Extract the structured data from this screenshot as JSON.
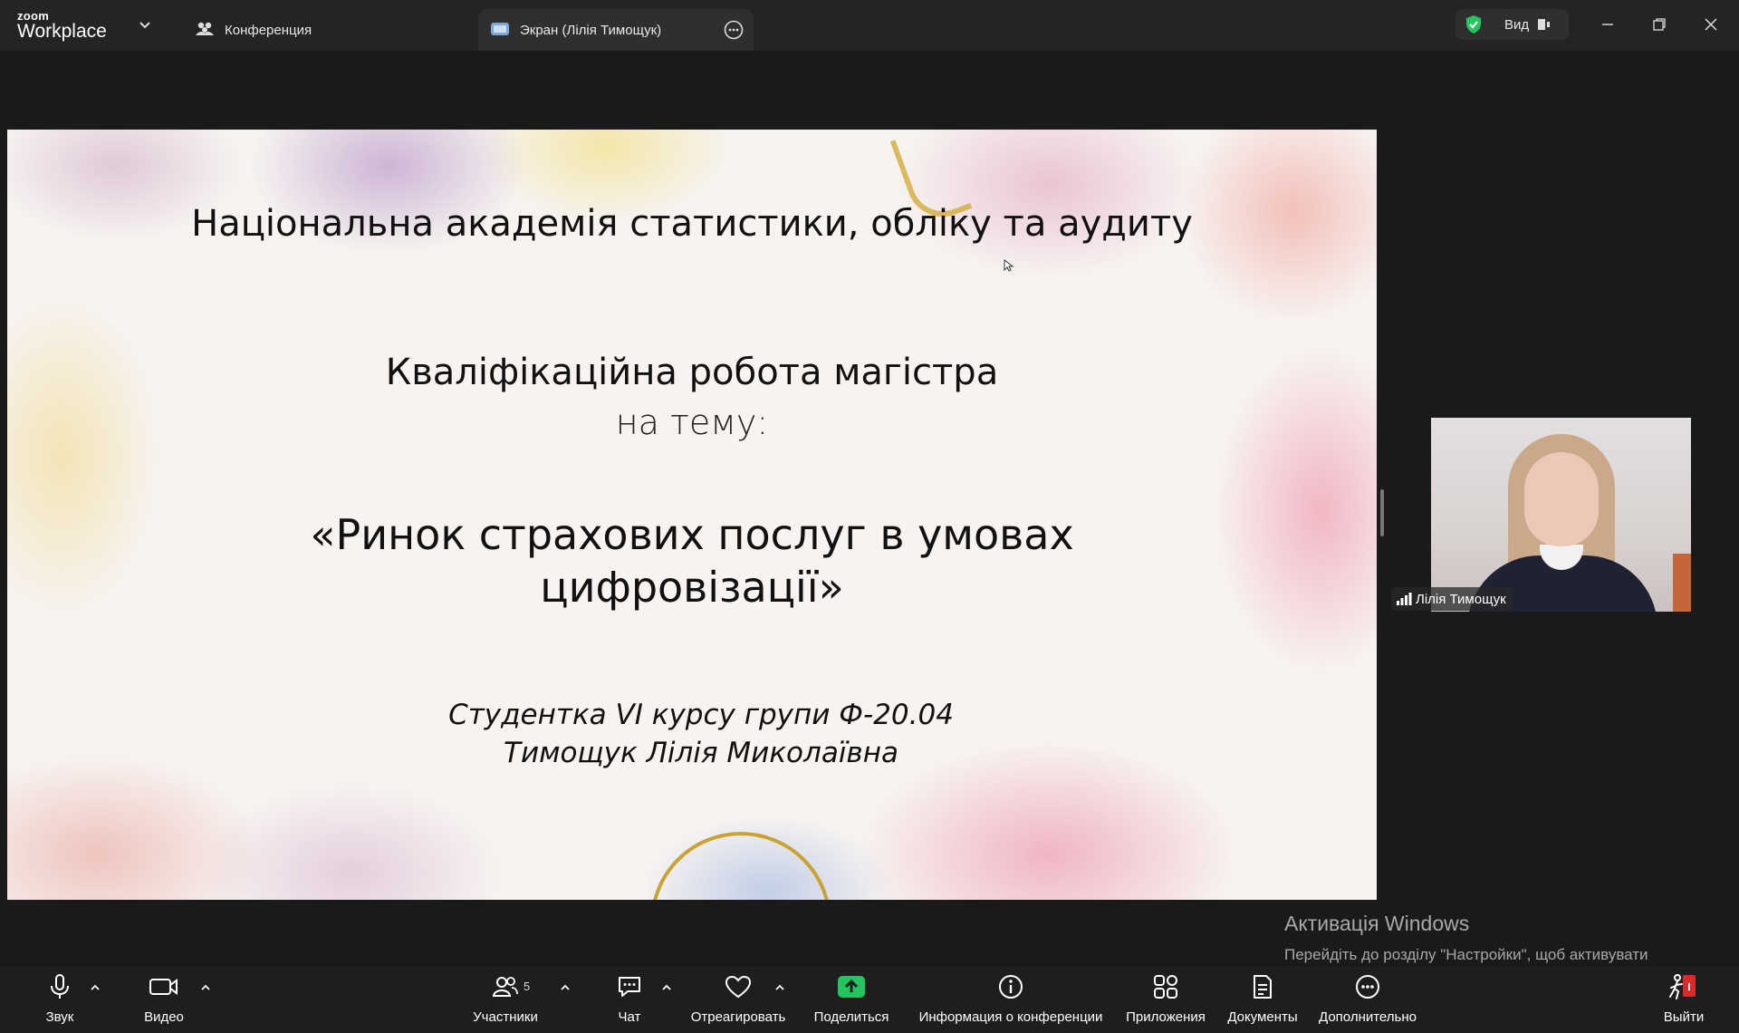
{
  "topbar": {
    "brand_small": "zoom",
    "brand_big": "Workplace",
    "tabs": [
      {
        "label": "Конференция",
        "icon": "people-icon"
      },
      {
        "label": "Экран (Лілія Тимощук)",
        "icon": "screen-share-icon"
      }
    ],
    "view_label": "Вид",
    "security_color": "#22c55e"
  },
  "slide": {
    "line1": "Національна академія статистики, обліку та аудиту",
    "line2": "Кваліфікаційна робота магістра",
    "line3": "на тему:",
    "line4": "«Ринок страхових послуг в умовах",
    "line5": "цифровізації»",
    "line6": "Студентка VI курсу групи Ф-20.04",
    "line7": "Тимощук Лілія Миколаївна"
  },
  "participant": {
    "name": "Лілія Тимощук"
  },
  "activation": {
    "title": "Активація Windows",
    "subtitle": "Перейдіть до розділу \"Настройки\", щоб активувати Windows."
  },
  "toolbar": {
    "audio": "Звук",
    "video": "Видео",
    "participants": "Участники",
    "participants_count": "5",
    "chat": "Чат",
    "react": "Отреагировать",
    "share": "Поделиться",
    "info": "Информация о конференции",
    "apps": "Приложения",
    "docs": "Документы",
    "more": "Дополнительно",
    "leave": "Выйти",
    "share_color": "#22c55e",
    "leave_color": "#e02828"
  }
}
